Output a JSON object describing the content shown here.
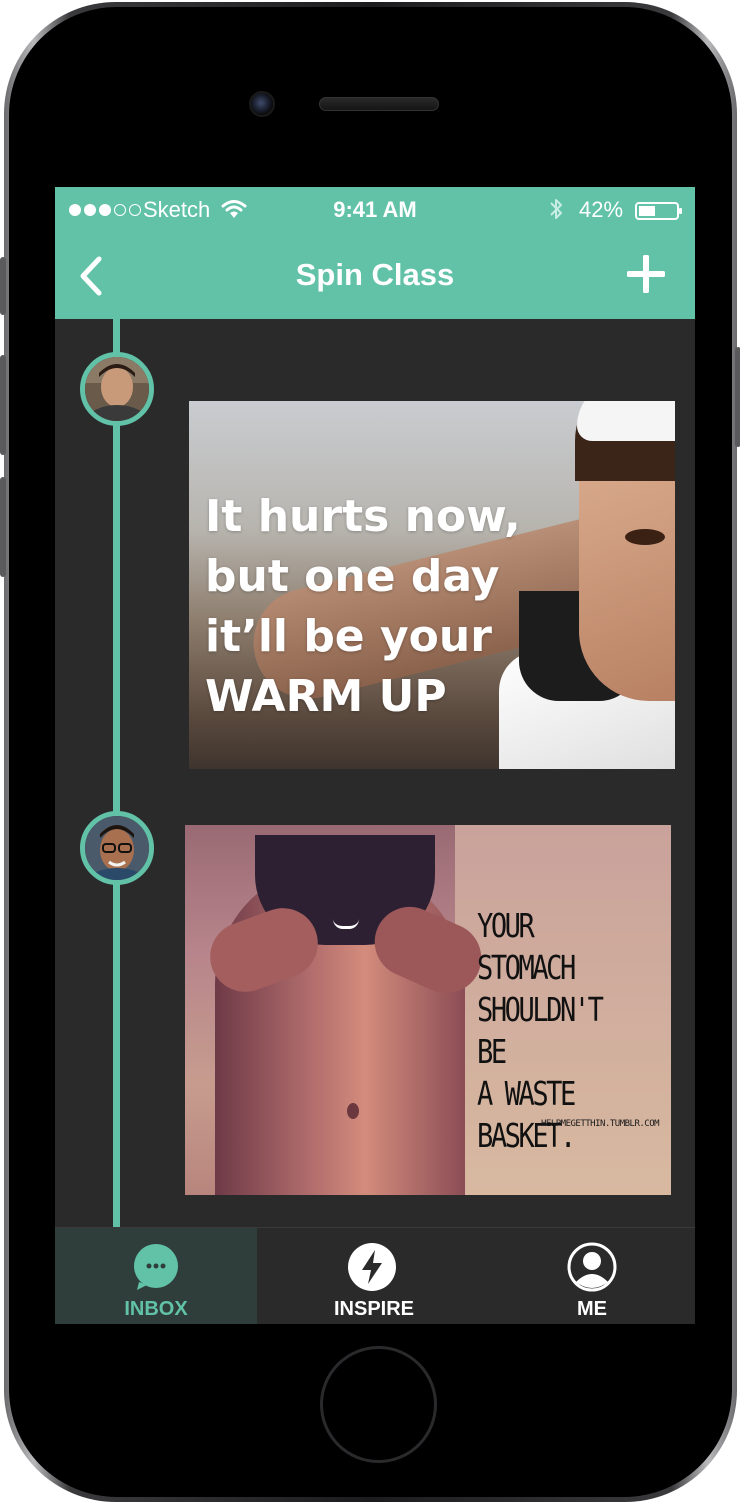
{
  "status_bar": {
    "carrier": "Sketch",
    "time": "9:41 AM",
    "battery": "42%"
  },
  "nav": {
    "title": "Spin Class"
  },
  "posts": [
    {
      "quote": "It hurts now,\nbut one day\nit’ll be your\nWARM UP"
    },
    {
      "quote": "YOUR\nSTOMACH\nSHOULDN'T BE\nA WASTE\nBASKET.",
      "credit": "HELPMEGETTHIN.TUMBLR.COM"
    }
  ],
  "tabbar": {
    "tabs": [
      {
        "label": "INBOX",
        "icon": "chat-bubble-icon",
        "active": true
      },
      {
        "label": "INSPIRE",
        "icon": "lightning-bolt-icon",
        "active": false
      },
      {
        "label": "ME",
        "icon": "user-profile-icon",
        "active": false
      }
    ]
  },
  "colors": {
    "accent": "#61c2a8",
    "background": "#2a2a2a",
    "text_on_accent": "#ffffff"
  }
}
